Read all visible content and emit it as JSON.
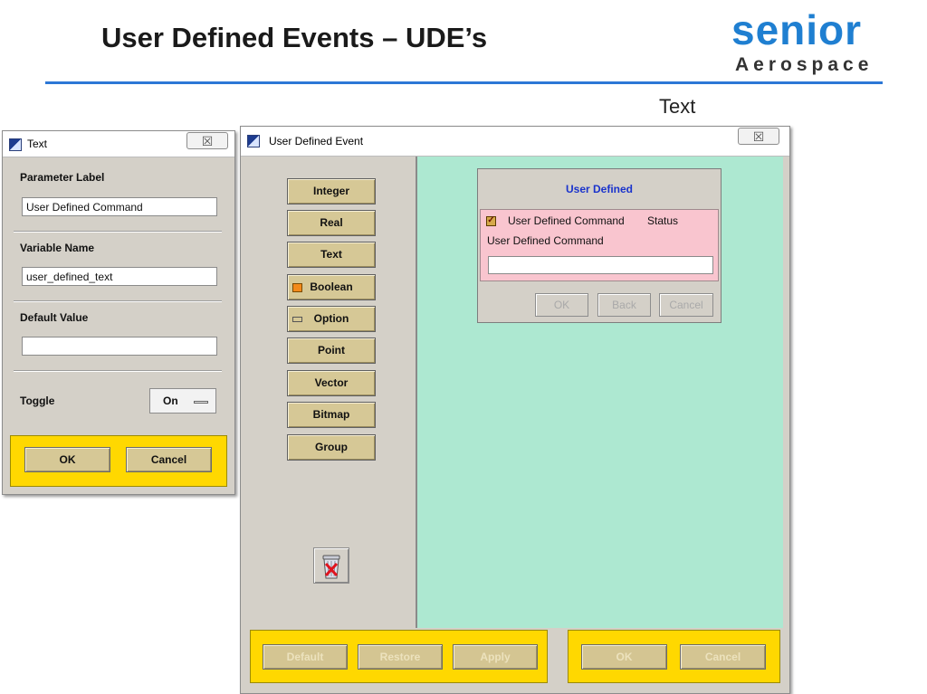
{
  "slide": {
    "title": "User Defined Events – UDE’s",
    "caption": "Text",
    "logo_word": "senior",
    "logo_sub": "Aerospace"
  },
  "text_dialog": {
    "title": "Text",
    "close_glyph": "☒",
    "param_label_heading": "Parameter Label",
    "param_label_value": "User Defined Command",
    "variable_name_heading": "Variable Name",
    "variable_name_value": "user_defined_text",
    "default_value_heading": "Default Value",
    "default_value_value": "",
    "toggle_heading": "Toggle",
    "toggle_value": "On",
    "ok_label": "OK",
    "cancel_label": "Cancel"
  },
  "ude_window": {
    "title": "User Defined Event",
    "close_glyph": "☒",
    "types": [
      "Integer",
      "Real",
      "Text",
      "Boolean",
      "Option",
      "Point",
      "Vector",
      "Bitmap",
      "Group"
    ],
    "bottom_left": [
      "Default",
      "Restore",
      "Apply"
    ],
    "bottom_right": [
      "OK",
      "Cancel"
    ]
  },
  "preview_dialog": {
    "title": "User Defined",
    "checkbox_label": "User Defined Command",
    "status_label": "Status",
    "field_label": "User Defined Command",
    "field_value": "",
    "buttons": [
      "OK",
      "Back",
      "Cancel"
    ]
  },
  "colors": {
    "accent_blue": "#2c77d6",
    "button_tan": "#d6c896",
    "footer_yellow": "#ffd800",
    "preview_green": "#ade8d1",
    "preview_pink": "#f9c5cf",
    "title_blue": "#1a33cc"
  },
  "icons": {
    "window": "window-app-icon",
    "close": "close-icon",
    "trash": "trash-icon",
    "checkbox": "checkbox-checked-icon"
  }
}
